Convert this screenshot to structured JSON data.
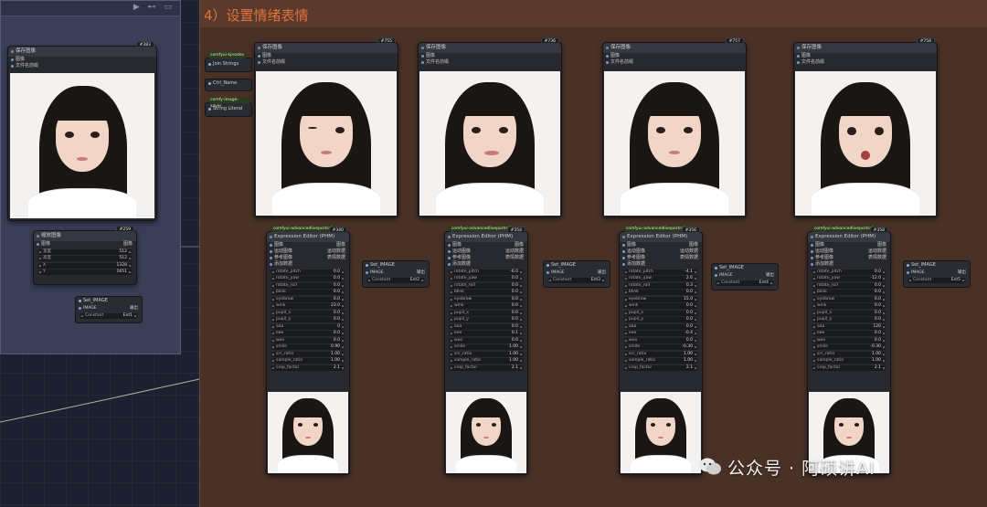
{
  "group": {
    "title": "4）设置情绪表情"
  },
  "colors": {
    "group_left": "#3a3e57",
    "group_main": "#4a3126",
    "title_accent": "#e0733a",
    "wire": "#c8e0b0"
  },
  "left": {
    "save_node": {
      "badge": "#383",
      "title": "保存图像",
      "inputs": [
        "图像",
        "文件名前缀"
      ]
    },
    "scale_node": {
      "badge": "#259",
      "title": "缩放图像",
      "input": "图像",
      "output": "图像",
      "widgets": [
        {
          "label": "宽度",
          "value": "512"
        },
        {
          "label": "高度",
          "value": "512"
        },
        {
          "label": "X",
          "value": "1328"
        },
        {
          "label": "Y",
          "value": "1651"
        }
      ]
    },
    "set_image": {
      "title": "Set_IMAGE",
      "port": "IMAGE",
      "port_r": "输出",
      "constant_label": "Constant",
      "constant_value": "Ent1"
    }
  },
  "helpers": {
    "source1": "comfyui-kjnodes",
    "join": "Join Strings",
    "ctrl": "Ctrl_Name",
    "source2": "comfy-image-saver",
    "literal": "String Literal"
  },
  "save_nodes": [
    {
      "badge": "#755",
      "title": "保存图像",
      "inputs": [
        "图像",
        "文件名前缀"
      ]
    },
    {
      "badge": "#736",
      "title": "保存图像",
      "inputs": [
        "图像",
        "文件名前缀"
      ]
    },
    {
      "badge": "#757",
      "title": "保存图像",
      "inputs": [
        "图像",
        "文件名前缀"
      ]
    },
    {
      "badge": "#758",
      "title": "保存图像",
      "inputs": [
        "图像",
        "文件名前缀"
      ]
    }
  ],
  "editor_common": {
    "source": "comfyui-advancedliveportrait",
    "title": "Expression Editor (PHM)",
    "rows": [
      {
        "l": "图像",
        "r": "图像"
      },
      {
        "l": "运动图像",
        "r": "运动数据"
      },
      {
        "l": "参考图像",
        "r": "表情数据"
      },
      {
        "l": "添加数据",
        "r": ""
      }
    ],
    "widget_labels": [
      "rotate_pitch",
      "rotate_yaw",
      "rotate_roll",
      "blink",
      "eyebrow",
      "wink",
      "pupil_x",
      "pupil_y",
      "aaa",
      "eee",
      "woo",
      "smile",
      "src_ratio",
      "sample_ratio",
      "crop_factor"
    ]
  },
  "editors": [
    {
      "badge": "#340",
      "values": [
        "0.0",
        "0.0",
        "0.0",
        "0.0",
        "0.0",
        "23.0",
        "0.0",
        "0.0",
        "0",
        "0.0",
        "0.0",
        "0.90",
        "1.00",
        "1.00",
        "2.1"
      ]
    },
    {
      "badge": "#354",
      "values": [
        "-6.0",
        "0.0",
        "0.0",
        "0.0",
        "0.0",
        "0.0",
        "0.0",
        "0.0",
        "0.0",
        "0.1",
        "0.0",
        "1.00",
        "1.00",
        "1.00",
        "2.1"
      ]
    },
    {
      "badge": "#356",
      "values": [
        "-4.1",
        "2.6",
        "0.3",
        "0.0",
        "15.0",
        "0.0",
        "0.0",
        "0.0",
        "0.0",
        "-0.4",
        "0.0",
        "-0.30",
        "1.00",
        "1.00",
        "2.1"
      ]
    },
    {
      "badge": "#358",
      "values": [
        "0.0",
        "-12.0",
        "0.0",
        "0.0",
        "0.0",
        "0.0",
        "0.0",
        "0.0",
        "120",
        "0.0",
        "0.0",
        "-0.30",
        "1.00",
        "1.00",
        "2.1"
      ]
    }
  ],
  "set_images": [
    {
      "title": "Set_IMAGE",
      "port": "IMAGE",
      "port_r": "输出",
      "constant_label": "Constant",
      "constant_value": "Ent2"
    },
    {
      "title": "Set_IMAGE",
      "port": "IMAGE",
      "port_r": "输出",
      "constant_label": "Constant",
      "constant_value": "Ent3"
    },
    {
      "title": "Set_IMAGE",
      "port": "IMAGE",
      "port_r": "输出",
      "constant_label": "Constant",
      "constant_value": "Ent4"
    },
    {
      "title": "Set_IMAGE",
      "port": "IMAGE",
      "port_r": "输出",
      "constant_label": "Constant",
      "constant_value": "Ent5"
    }
  ],
  "watermark": "公众号 · 阿硕讲AI"
}
